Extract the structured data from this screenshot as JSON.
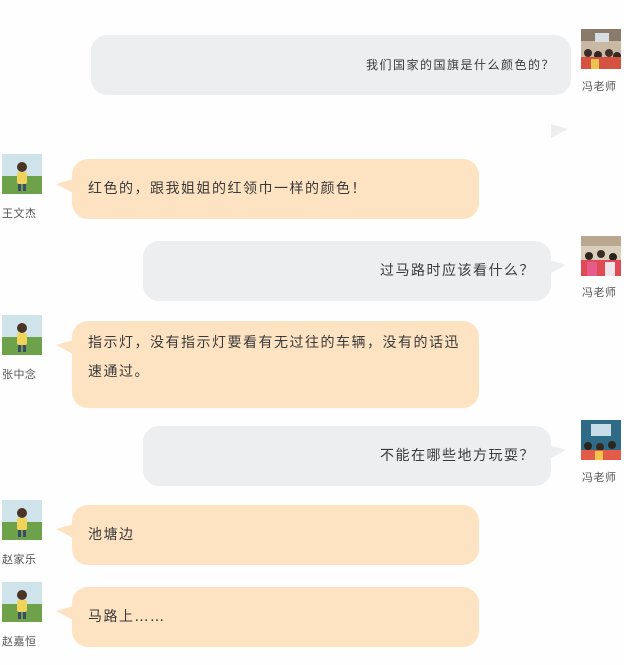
{
  "messages": [
    {
      "speaker": "冯老师",
      "side": "right",
      "text": "我们国家的国旗是什么颜色的？"
    },
    {
      "speaker": "王文杰",
      "side": "left",
      "text": "红色的，跟我姐姐的红领巾一样的颜色！"
    },
    {
      "speaker": "冯老师",
      "side": "right",
      "text": "过马路时应该看什么？"
    },
    {
      "speaker": "张中念",
      "side": "left",
      "text": "指示灯，没有指示灯要看有无过往的车辆，没有的话迅速通过。"
    },
    {
      "speaker": "冯老师",
      "side": "right",
      "text": "不能在哪些地方玩耍？"
    },
    {
      "speaker": "赵家乐",
      "side": "left",
      "text": "池塘边"
    },
    {
      "speaker": "赵嘉恒",
      "side": "left",
      "text": "马路上……"
    }
  ],
  "colors": {
    "teacher_bubble": "#eceef0",
    "student_bubble": "#fde3c2",
    "page_background": "#fefefe"
  },
  "icons": {
    "teacher_avatar": "classroom-photo-icon",
    "student_avatar": "child-on-grass-photo-icon"
  }
}
